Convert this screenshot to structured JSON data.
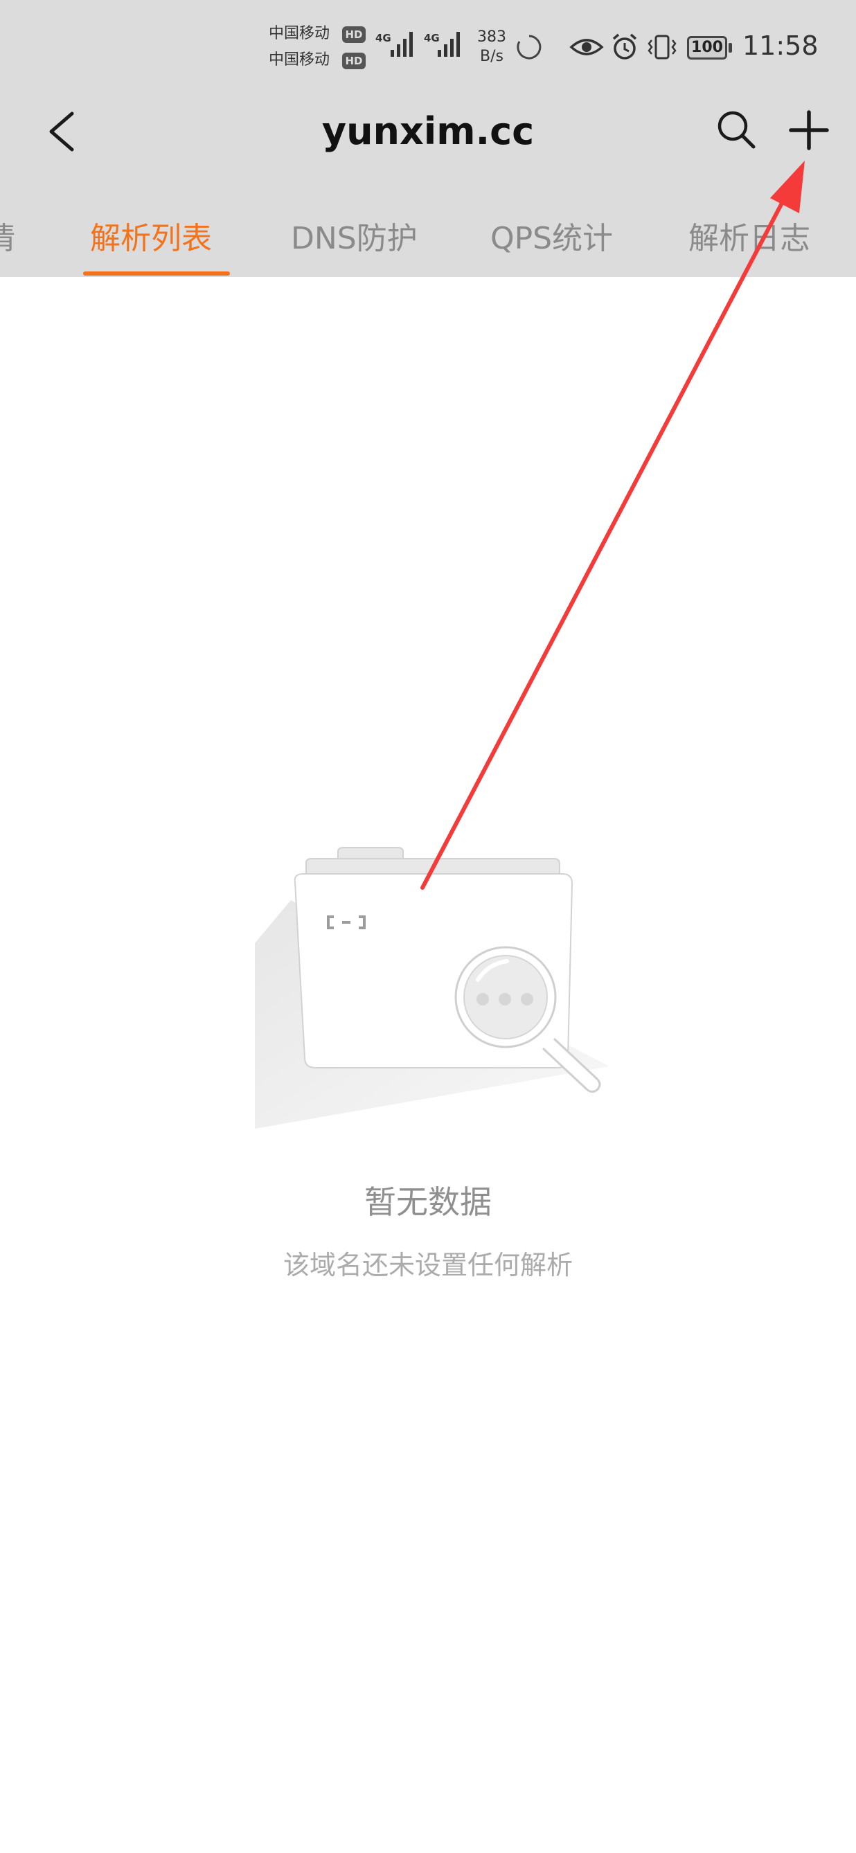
{
  "status_bar": {
    "carrier_1": "中国移动",
    "carrier_2": "中国移动",
    "hd": "HD",
    "net_type": "4G",
    "speed_value": "383",
    "speed_unit": "B/s",
    "battery": "100",
    "time": "11:58"
  },
  "nav": {
    "title": "yunxim.cc"
  },
  "tabs": [
    {
      "label": "情",
      "active": false
    },
    {
      "label": "解析列表",
      "active": true
    },
    {
      "label": "DNS防护",
      "active": false
    },
    {
      "label": "QPS统计",
      "active": false
    },
    {
      "label": "解析日志",
      "active": false
    }
  ],
  "empty_state": {
    "title": "暂无数据",
    "subtitle": "该域名还未设置任何解析"
  },
  "colors": {
    "accent": "#f2731c",
    "header_bg": "#dcdcdc",
    "annotation_arrow": "#f53a3a"
  },
  "icons": [
    "back-chevron-icon",
    "search-icon",
    "plus-icon",
    "empty-folder-magnifier-illustration"
  ]
}
